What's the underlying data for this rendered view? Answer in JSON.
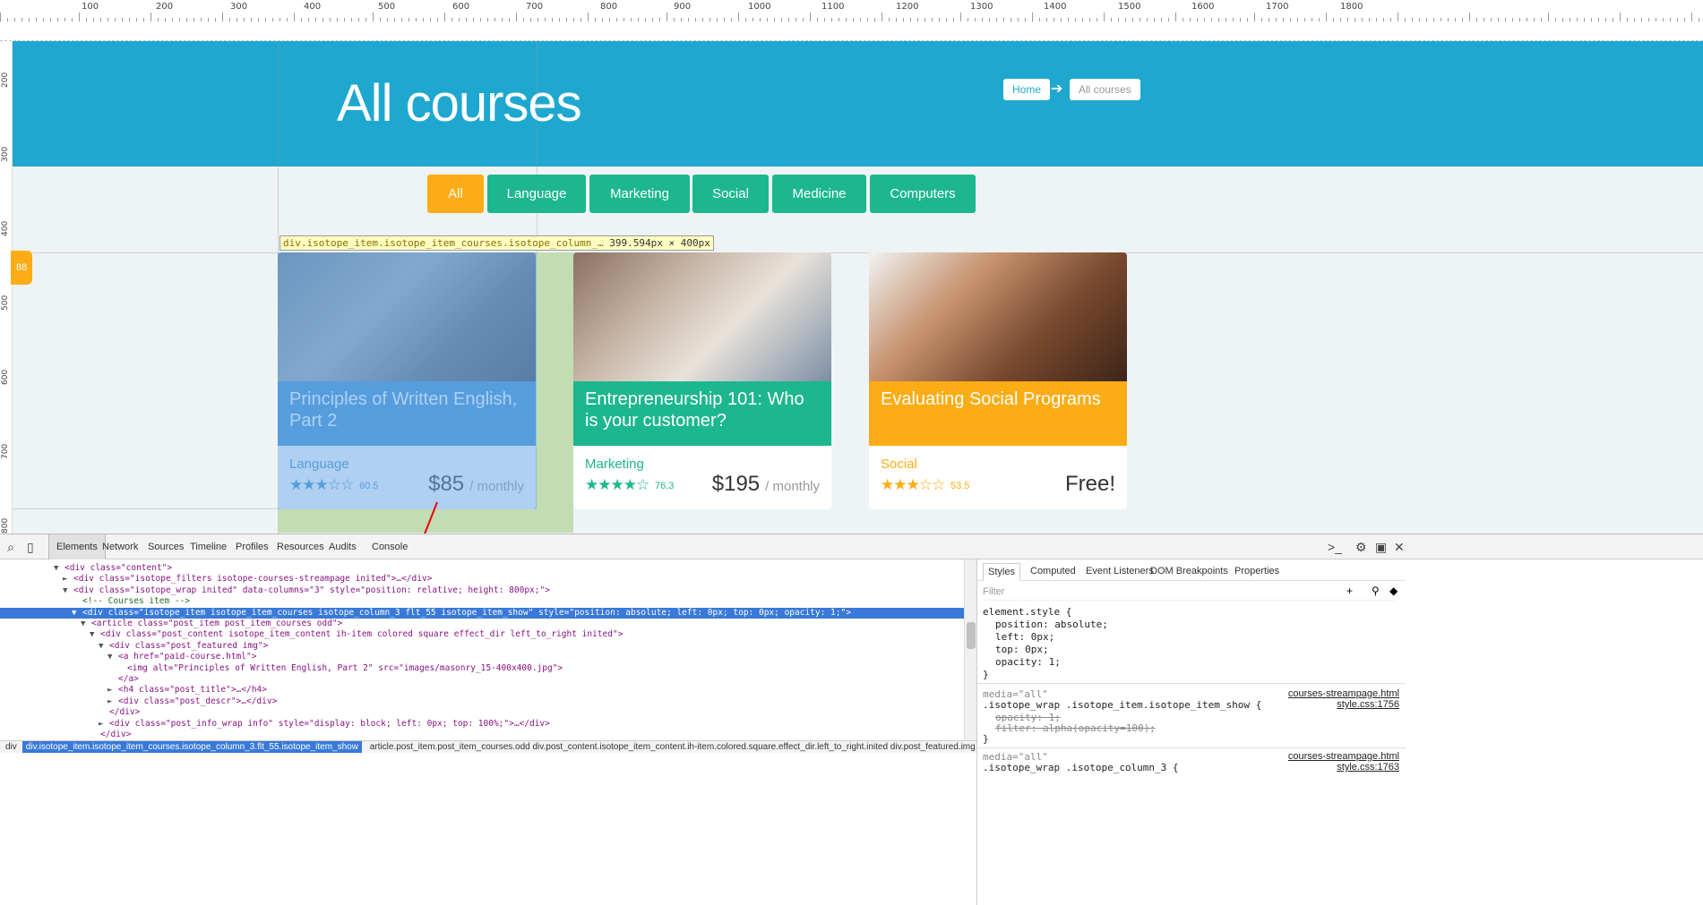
{
  "ruler": {
    "top_labels": [
      "100",
      "200",
      "300",
      "400",
      "500",
      "600",
      "700",
      "800",
      "900",
      "1000",
      "1100",
      "1200",
      "1300",
      "1400",
      "1500",
      "1600",
      "1700",
      "1800"
    ],
    "left_labels": [
      "200",
      "300",
      "400",
      "500",
      "600",
      "700",
      "800"
    ]
  },
  "hero": {
    "title": "All courses",
    "breadcrumb_home": "Home",
    "breadcrumb_arrow": "➔",
    "breadcrumb_current": "All courses",
    "color": "#1fa8cf"
  },
  "side_tab": {
    "label": "88"
  },
  "filters": [
    {
      "label": "All",
      "active": true
    },
    {
      "label": "Language",
      "active": false
    },
    {
      "label": "Marketing",
      "active": false
    },
    {
      "label": "Social",
      "active": false
    },
    {
      "label": "Medicine",
      "active": false
    },
    {
      "label": "Computers",
      "active": false
    }
  ],
  "tooltip": {
    "selector": "div.isotope_item.isotope_item_courses.isotope_column_…",
    "size": "399.594px × 400px"
  },
  "courses": [
    {
      "title": "Principles of Written English, Part 2",
      "category": "Language",
      "rating": "60.5",
      "stars": 3,
      "price": "$85",
      "per": "/ monthly",
      "color": "#3a8fd4",
      "cat_color": "#3a8fd4",
      "image": "teacher-with-students-icon"
    },
    {
      "title": "Entrepreneurship 101: Who is your customer?",
      "category": "Marketing",
      "rating": "76.3",
      "stars": 4,
      "price": "$195",
      "per": "/ monthly",
      "color": "#1cb78e",
      "cat_color": "#1cb78e",
      "image": "hands-writing-icon"
    },
    {
      "title": "Evaluating Social Programs",
      "category": "Social",
      "rating": "53.5",
      "stars": 3,
      "price": "Free!",
      "per": "",
      "color": "#fcac14",
      "cat_color": "#fcac14",
      "image": "smiling-children-icon"
    }
  ],
  "devtools": {
    "tabs": [
      "Elements",
      "Network",
      "Sources",
      "Timeline",
      "Profiles",
      "Resources",
      "Audits",
      "Console"
    ],
    "dom": [
      {
        "indent": 6,
        "tri": "▼",
        "html": "<div class=\"content\">"
      },
      {
        "indent": 7,
        "tri": "►",
        "html": "<div class=\"isotope_filters isotope-courses-streampage inited\">…</div>"
      },
      {
        "indent": 7,
        "tri": "▼",
        "html": "<div class=\"isotope_wrap inited\" data-columns=\"3\" style=\"position: relative; height: 800px;\">"
      },
      {
        "indent": 8,
        "tri": "",
        "html": "<!-- Courses item -->"
      },
      {
        "indent": 8,
        "tri": "▼",
        "html": "<div class=\"isotope_item isotope_item_courses isotope_column_3 flt_55 isotope_item_show\" style=\"position: absolute; left: 0px; top: 0px; opacity: 1;\">",
        "selected": true
      },
      {
        "indent": 9,
        "tri": "▼",
        "html": "<article class=\"post_item post_item_courses odd\">"
      },
      {
        "indent": 10,
        "tri": "▼",
        "html": "<div class=\"post_content isotope_item_content ih-item colored square effect_dir left_to_right inited\">"
      },
      {
        "indent": 11,
        "tri": "▼",
        "html": "<div class=\"post_featured img\">"
      },
      {
        "indent": 12,
        "tri": "▼",
        "html": "<a href=\"paid-course.html\">"
      },
      {
        "indent": 13,
        "tri": "",
        "html": "<img alt=\"Principles of Written English, Part 2\" src=\"images/masonry_15-400x400.jpg\">"
      },
      {
        "indent": 12,
        "tri": "",
        "html": "</a>"
      },
      {
        "indent": 12,
        "tri": "►",
        "html": "<h4 class=\"post_title\">…</h4>"
      },
      {
        "indent": 12,
        "tri": "►",
        "html": "<div class=\"post_descr\">…</div>"
      },
      {
        "indent": 11,
        "tri": "",
        "html": "</div>"
      },
      {
        "indent": 11,
        "tri": "►",
        "html": "<div class=\"post_info_wrap info\" style=\"display: block; left: 0px; top: 100%;\">…</div>"
      },
      {
        "indent": 10,
        "tri": "",
        "html": "</div>"
      },
      {
        "indent": 9,
        "tri": "",
        "html": "</article>"
      }
    ],
    "breadcrumb_sel": "div.isotope_item.isotope_item_courses.isotope_column_3.flt_55.isotope_item_show",
    "breadcrumb_rest": "article.post_item.post_item_courses.odd    div.post_content.isotope_item_content.ih-item.colored.square.effect_dir.left_to_right.inited    div.post_featured.img    a    img",
    "breadcrumb_first": "div",
    "styles_tabs": [
      "Styles",
      "Computed",
      "Event Listeners",
      "DOM Breakpoints",
      "Properties"
    ],
    "filter_placeholder": "Filter",
    "element_style": {
      "header": "element.style {",
      "props": [
        "position: absolute;",
        "left: 0px;",
        "top: 0px;",
        "opacity: 1;"
      ],
      "close": "}"
    },
    "rule1": {
      "media": "media=\"all\"",
      "src": "courses-streampage.html",
      "src2": "style.css:1756",
      "selector": ".isotope_wrap .isotope_item.isotope_item_show {",
      "props": [
        "opacity: 1;",
        "filter: alpha(opacity=100);"
      ],
      "close": "}"
    },
    "rule2": {
      "media": "media=\"all\"",
      "src": "courses-streampage.html",
      "src2": "style.css:1763",
      "selector": ".isotope_wrap .isotope_column_3 {"
    }
  }
}
